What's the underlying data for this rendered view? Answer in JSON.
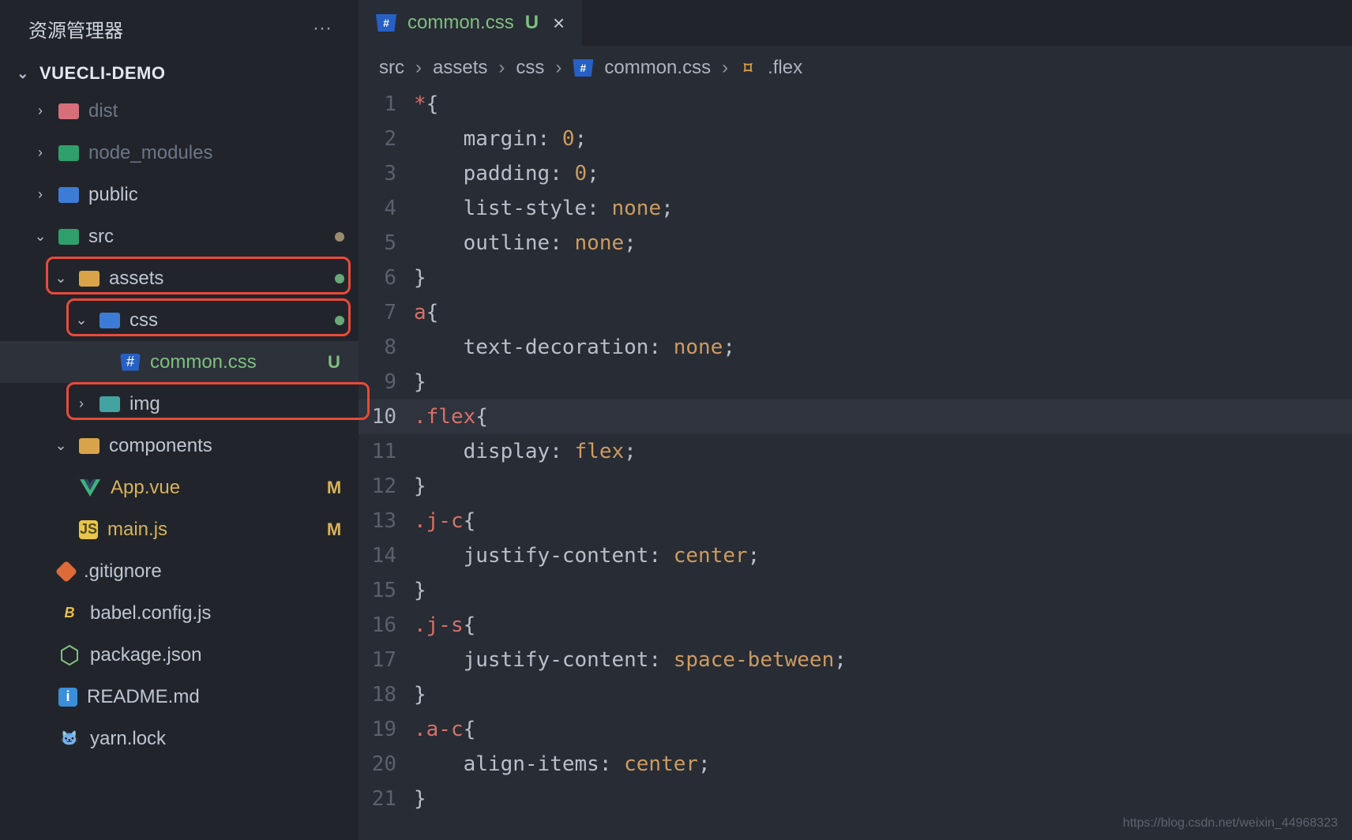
{
  "explorer": {
    "title": "资源管理器",
    "project": "VUECLI-DEMO",
    "tree": [
      {
        "name": "dist",
        "kind": "folder",
        "open": false,
        "depth": 0,
        "icon": "folder-pink",
        "dim": true
      },
      {
        "name": "node_modules",
        "kind": "folder",
        "open": false,
        "depth": 0,
        "icon": "folder-green",
        "dim": true
      },
      {
        "name": "public",
        "kind": "folder",
        "open": false,
        "depth": 0,
        "icon": "folder-blue"
      },
      {
        "name": "src",
        "kind": "folder",
        "open": true,
        "depth": 0,
        "icon": "folder-code",
        "dot": "#9a8a6f"
      },
      {
        "name": "assets",
        "kind": "folder",
        "open": true,
        "depth": 1,
        "icon": "folder-orange",
        "dot": "#69a87a",
        "highlight": true
      },
      {
        "name": "css",
        "kind": "folder",
        "open": true,
        "depth": 2,
        "icon": "folder-blue",
        "dot": "#69a87a",
        "highlight": true
      },
      {
        "name": "common.css",
        "kind": "file",
        "depth": 3,
        "icon": "css",
        "status": "U",
        "statusClass": "unt",
        "selected": true,
        "labelClass": "green"
      },
      {
        "name": "img",
        "kind": "folder",
        "open": false,
        "depth": 2,
        "icon": "folder-teal",
        "highlight": true
      },
      {
        "name": "components",
        "kind": "folder",
        "open": true,
        "depth": 1,
        "icon": "folder-orange"
      },
      {
        "name": "App.vue",
        "kind": "file",
        "depth": 1,
        "icon": "vue",
        "status": "M",
        "statusClass": "mod"
      },
      {
        "name": "main.js",
        "kind": "file",
        "depth": 1,
        "icon": "js",
        "status": "M",
        "statusClass": "mod"
      },
      {
        "name": ".gitignore",
        "kind": "file",
        "depth": 0,
        "icon": "git"
      },
      {
        "name": "babel.config.js",
        "kind": "file",
        "depth": 0,
        "icon": "babel"
      },
      {
        "name": "package.json",
        "kind": "file",
        "depth": 0,
        "icon": "node"
      },
      {
        "name": "README.md",
        "kind": "file",
        "depth": 0,
        "icon": "info"
      },
      {
        "name": "yarn.lock",
        "kind": "file",
        "depth": 0,
        "icon": "yarn"
      }
    ]
  },
  "tabs": [
    {
      "file": "common.css",
      "status": "U",
      "icon": "css"
    }
  ],
  "breadcrumb": [
    {
      "label": "src"
    },
    {
      "label": "assets"
    },
    {
      "label": "css"
    },
    {
      "label": "common.css",
      "icon": "css"
    },
    {
      "label": ".flex",
      "icon": "symbol"
    }
  ],
  "editor": {
    "language": "css",
    "activeFile": "common.css",
    "currentLine": 10,
    "code": [
      {
        "n": 1,
        "tokens": [
          [
            "sel",
            "*"
          ],
          [
            "pun",
            "{"
          ]
        ]
      },
      {
        "n": 2,
        "tokens": [
          [
            "ind",
            "    "
          ],
          [
            "prop",
            "margin"
          ],
          [
            "pun",
            ": "
          ],
          [
            "num",
            "0"
          ],
          [
            "pun",
            ";"
          ]
        ]
      },
      {
        "n": 3,
        "tokens": [
          [
            "ind",
            "    "
          ],
          [
            "prop",
            "padding"
          ],
          [
            "pun",
            ": "
          ],
          [
            "num",
            "0"
          ],
          [
            "pun",
            ";"
          ]
        ]
      },
      {
        "n": 4,
        "tokens": [
          [
            "ind",
            "    "
          ],
          [
            "prop",
            "list-style"
          ],
          [
            "pun",
            ": "
          ],
          [
            "val",
            "none"
          ],
          [
            "pun",
            ";"
          ]
        ]
      },
      {
        "n": 5,
        "tokens": [
          [
            "ind",
            "    "
          ],
          [
            "prop",
            "outline"
          ],
          [
            "pun",
            ": "
          ],
          [
            "val",
            "none"
          ],
          [
            "pun",
            ";"
          ]
        ]
      },
      {
        "n": 6,
        "tokens": [
          [
            "pun",
            "}"
          ]
        ]
      },
      {
        "n": 7,
        "tokens": [
          [
            "sel",
            "a"
          ],
          [
            "pun",
            "{"
          ]
        ]
      },
      {
        "n": 8,
        "tokens": [
          [
            "ind",
            "    "
          ],
          [
            "prop",
            "text-decoration"
          ],
          [
            "pun",
            ": "
          ],
          [
            "val",
            "none"
          ],
          [
            "pun",
            ";"
          ]
        ]
      },
      {
        "n": 9,
        "tokens": [
          [
            "pun",
            "}"
          ]
        ]
      },
      {
        "n": 10,
        "tokens": [
          [
            "sel",
            ".flex"
          ],
          [
            "pun",
            "{"
          ]
        ]
      },
      {
        "n": 11,
        "tokens": [
          [
            "ind",
            "    "
          ],
          [
            "prop",
            "display"
          ],
          [
            "pun",
            ": "
          ],
          [
            "val",
            "flex"
          ],
          [
            "pun",
            ";"
          ]
        ]
      },
      {
        "n": 12,
        "tokens": [
          [
            "pun",
            "}"
          ]
        ]
      },
      {
        "n": 13,
        "tokens": [
          [
            "sel",
            ".j-c"
          ],
          [
            "pun",
            "{"
          ]
        ]
      },
      {
        "n": 14,
        "tokens": [
          [
            "ind",
            "    "
          ],
          [
            "prop",
            "justify-content"
          ],
          [
            "pun",
            ": "
          ],
          [
            "val",
            "center"
          ],
          [
            "pun",
            ";"
          ]
        ]
      },
      {
        "n": 15,
        "tokens": [
          [
            "pun",
            "}"
          ]
        ]
      },
      {
        "n": 16,
        "tokens": [
          [
            "sel",
            ".j-s"
          ],
          [
            "pun",
            "{"
          ]
        ]
      },
      {
        "n": 17,
        "tokens": [
          [
            "ind",
            "    "
          ],
          [
            "prop",
            "justify-content"
          ],
          [
            "pun",
            ": "
          ],
          [
            "val",
            "space-between"
          ],
          [
            "pun",
            ";"
          ]
        ]
      },
      {
        "n": 18,
        "tokens": [
          [
            "pun",
            "}"
          ]
        ]
      },
      {
        "n": 19,
        "tokens": [
          [
            "sel",
            ".a-c"
          ],
          [
            "pun",
            "{"
          ]
        ]
      },
      {
        "n": 20,
        "tokens": [
          [
            "ind",
            "    "
          ],
          [
            "prop",
            "align-items"
          ],
          [
            "pun",
            ": "
          ],
          [
            "val",
            "center"
          ],
          [
            "pun",
            ";"
          ]
        ]
      },
      {
        "n": 21,
        "tokens": [
          [
            "pun",
            "}"
          ]
        ]
      }
    ]
  },
  "watermark": "https://blog.csdn.net/weixin_44968323"
}
